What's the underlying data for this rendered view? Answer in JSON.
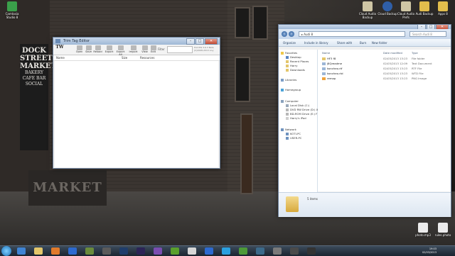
{
  "desktop": {
    "wallpaper_signs": {
      "sign_main": "DOCK STREET MARKET",
      "sign_sub": "BAKERY CAFE BAR SOCIAL",
      "storefront": "MARKET"
    },
    "icons_left": [
      {
        "label": "Camtasia Studio 8",
        "color": "#3aa04a"
      }
    ],
    "icons_top_right": [
      {
        "label": "Cloud Audio Backup",
        "color": "#cfc6a5"
      },
      {
        "label": "Cloud Backup",
        "color": "#2f5fa8"
      },
      {
        "label": "Cloud Audio Prefs",
        "color": "#cfc6a5"
      },
      {
        "label": "Audi Backup",
        "color": "#e2bd4c"
      },
      {
        "label": "Apps 8",
        "color": "#e2bd4c"
      }
    ],
    "icons_bottom_right": [
      {
        "label": "photo.mp3",
        "color": "#ececec"
      },
      {
        "label": "rules.photo",
        "color": "#ececec"
      }
    ]
  },
  "tag_window": {
    "title": "Trim Tag Editor",
    "toolbar": [
      "Open",
      "Save",
      "Reload",
      "Export",
      "Export All",
      "Import",
      "View",
      "Edit"
    ],
    "logo": "TW",
    "filter_label": "Filter",
    "version": "TrimTW 3.6.3 Beta (C)2008-2013 Any",
    "columns": [
      "Name",
      "Size",
      "Resources"
    ]
  },
  "explorer": {
    "address": "Audi 8",
    "search_placeholder": "Search Audi 8",
    "commands": [
      "Organize",
      "Include in library",
      "Share with",
      "Burn",
      "New folder"
    ],
    "nav": {
      "favorites_label": "Favorites",
      "favorites": [
        "Desktop",
        "Recent Places",
        "Harry",
        "Downloads"
      ],
      "libraries_label": "Libraries",
      "homegroup_label": "Homegroup",
      "computer_label": "Computer",
      "drives": [
        "Local Disk (C:)",
        "DVD RW Drive (D:) X",
        "BD-ROM Drive (E:) F",
        "Harry's iPod"
      ],
      "network_label": "Network",
      "network": [
        "KOTI-PC",
        "USER-PC"
      ]
    },
    "columns": [
      "Name",
      "Date modified",
      "Type"
    ],
    "files": [
      {
        "name": "HF3 f8",
        "date": "02/03/2013 13:23",
        "type": "File folder",
        "color": "#e3c66b"
      },
      {
        "name": "j8Qreadme",
        "date": "02/03/2013 12:09",
        "type": "Text Document",
        "color": "#9cb6d6"
      },
      {
        "name": "koncheo.rtf",
        "date": "02/03/2013 13:23",
        "type": "RTF File",
        "color": "#9cb6d6"
      },
      {
        "name": "koncheo.rtd",
        "date": "02/03/2013 13:23",
        "type": "WTD File",
        "color": "#9cb6d6"
      },
      {
        "name": "remap",
        "date": "02/03/2013 13:23",
        "type": "PNG Image",
        "color": "#f0a33c"
      }
    ],
    "details_text": "5 items"
  },
  "taskbar": {
    "apps": [
      {
        "name": "ie",
        "color": "#3f84d4"
      },
      {
        "name": "explorer",
        "color": "#e3c66b"
      },
      {
        "name": "firefox",
        "color": "#e07a2b"
      },
      {
        "name": "media",
        "color": "#2d6ad0"
      },
      {
        "name": "game",
        "color": "#6a8b3c"
      },
      {
        "name": "app6",
        "color": "#5b5b5b"
      },
      {
        "name": "photoshop",
        "color": "#1f3d6b"
      },
      {
        "name": "aftereffects",
        "color": "#2c2456"
      },
      {
        "name": "app9",
        "color": "#7a4db0"
      },
      {
        "name": "spotify",
        "color": "#5aa02c"
      },
      {
        "name": "app11",
        "color": "#d6d6d6"
      },
      {
        "name": "app12",
        "color": "#2d6ad0"
      },
      {
        "name": "skype",
        "color": "#2aa0e0"
      },
      {
        "name": "utorrent",
        "color": "#4d9a38"
      },
      {
        "name": "wordpress",
        "color": "#3c6a8a"
      },
      {
        "name": "app16",
        "color": "#7a7a7a"
      },
      {
        "name": "app17",
        "color": "#4a4a4a"
      },
      {
        "name": "app18",
        "color": "#333333"
      }
    ],
    "clock_time": "19:03",
    "clock_date": "02/03/2013"
  }
}
